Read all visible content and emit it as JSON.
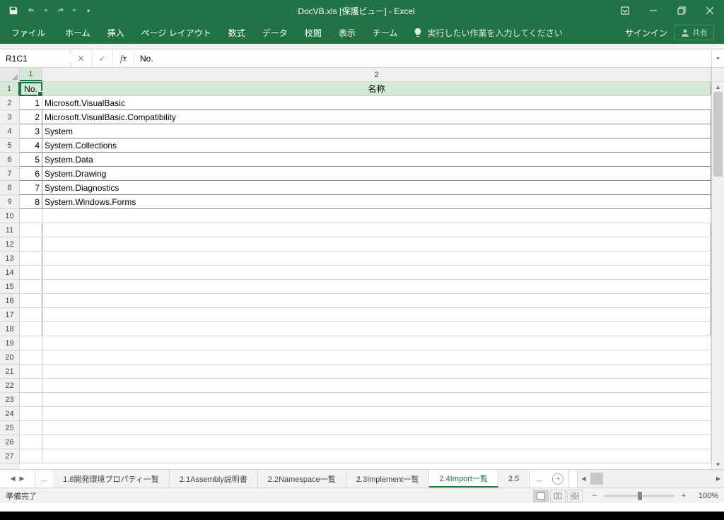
{
  "titlebar": {
    "title": "DocVB.xls  [保護ビュー] - Excel"
  },
  "ribbon": {
    "tabs": [
      "ファイル",
      "ホーム",
      "挿入",
      "ページ レイアウト",
      "数式",
      "データ",
      "校閲",
      "表示",
      "チーム"
    ],
    "tell_me": "実行したい作業を入力してください",
    "sign_in": "サインイン",
    "share": "共有"
  },
  "formula": {
    "name_box": "R1C1",
    "value": "No."
  },
  "columns": [
    "1",
    "2"
  ],
  "headers": {
    "a": "No.",
    "b": "名称"
  },
  "rows": [
    {
      "n": "1",
      "name": "Microsoft.VisualBasic"
    },
    {
      "n": "2",
      "name": "Microsoft.VisualBasic.Compatibility"
    },
    {
      "n": "3",
      "name": "System"
    },
    {
      "n": "4",
      "name": "System.Collections"
    },
    {
      "n": "5",
      "name": "System.Data"
    },
    {
      "n": "6",
      "name": "System.Drawing"
    },
    {
      "n": "7",
      "name": "System.Diagnostics"
    },
    {
      "n": "8",
      "name": "System.Windows.Forms"
    }
  ],
  "row_numbers": [
    "1",
    "2",
    "3",
    "4",
    "5",
    "6",
    "7",
    "8",
    "9",
    "10",
    "11",
    "12",
    "13",
    "14",
    "15",
    "16",
    "17",
    "18",
    "19",
    "20",
    "21",
    "22",
    "23",
    "24",
    "25",
    "26",
    "27"
  ],
  "sheets": {
    "tabs": [
      "1.8開発環境プロパティ一覧",
      "2.1Assembly説明書",
      "2.2Namespace一覧",
      "2.3Implement一覧",
      "2.4Import一覧",
      "2.5"
    ],
    "active_index": 4
  },
  "status": {
    "ready": "準備完了",
    "zoom": "100%"
  }
}
